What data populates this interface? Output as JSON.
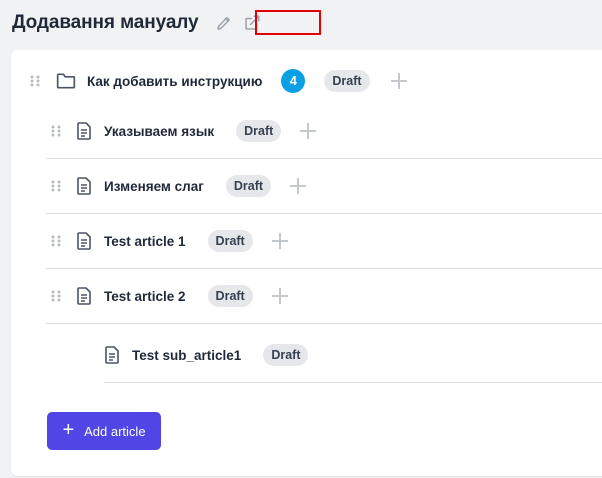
{
  "header": {
    "title": "Додавання мануалу"
  },
  "section": {
    "label": "Как добавить инструкцию",
    "count": "4",
    "status": "Draft"
  },
  "articles": [
    {
      "label": "Указываем язык",
      "status": "Draft"
    },
    {
      "label": "Изменяем слаг",
      "status": "Draft"
    },
    {
      "label": "Test article 1",
      "status": "Draft"
    },
    {
      "label": "Test article 2",
      "status": "Draft"
    }
  ],
  "sub_article": {
    "label": "Test sub_article1",
    "status": "Draft"
  },
  "add_article": {
    "label": "Add article",
    "icon": "plus-icon"
  },
  "colors": {
    "accent": "#4f46e5",
    "count_badge": "#0aa1e4",
    "highlight": "#e30000"
  }
}
